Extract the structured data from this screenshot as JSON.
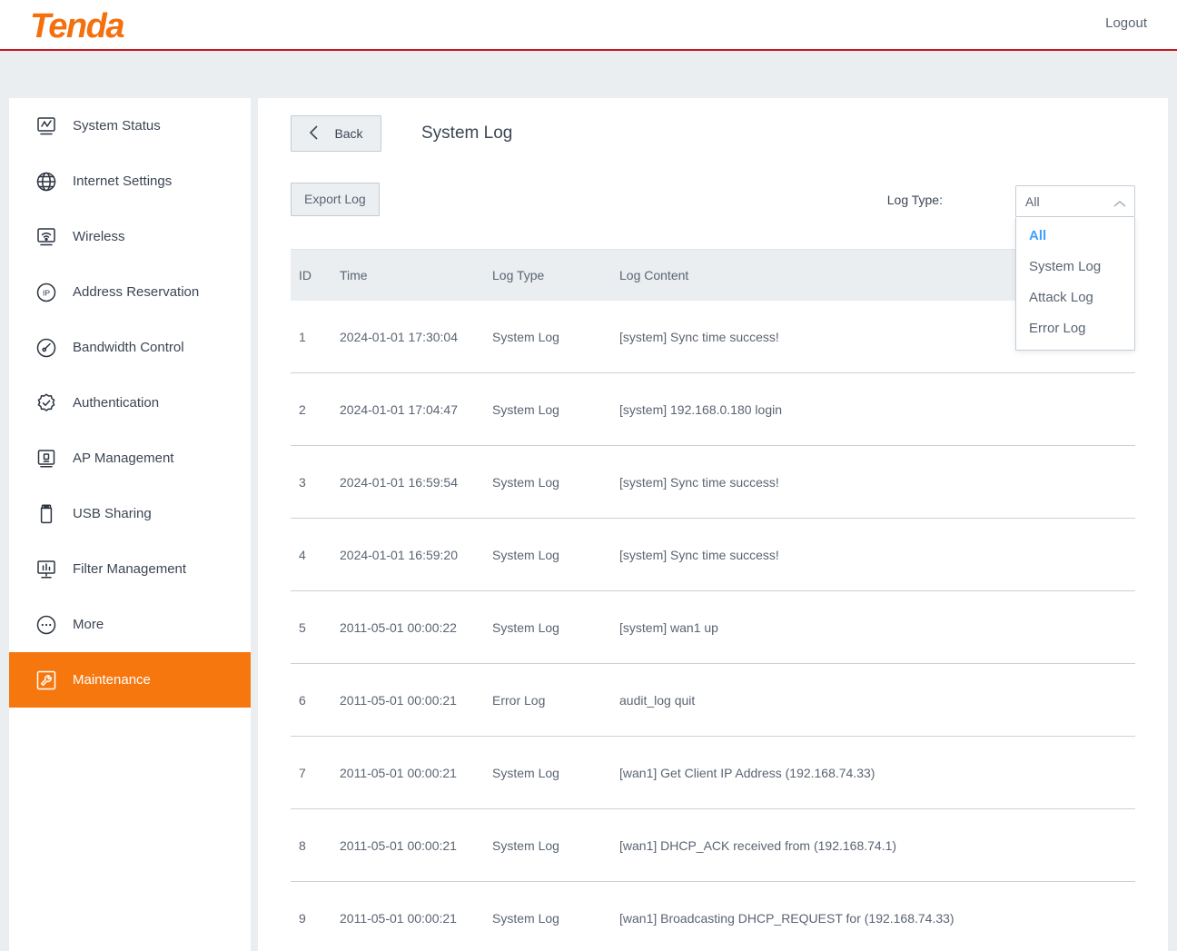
{
  "topbar": {
    "brand": "Tenda",
    "logout_label": "Logout"
  },
  "colors": {
    "brand_orange": "#f7770f",
    "accent_red": "#c8161e",
    "link_blue": "#409eff",
    "page_bg": "#eaeef0"
  },
  "sidebar": {
    "items": [
      {
        "label": "System Status",
        "icon": "monitor-chart-icon",
        "active": false
      },
      {
        "label": "Internet Settings",
        "icon": "globe-icon",
        "active": false
      },
      {
        "label": "Wireless",
        "icon": "wifi-monitor-icon",
        "active": false
      },
      {
        "label": "Address Reservation",
        "icon": "ip-circle-icon",
        "active": false
      },
      {
        "label": "Bandwidth Control",
        "icon": "gauge-icon",
        "active": false
      },
      {
        "label": "Authentication",
        "icon": "badge-check-icon",
        "active": false
      },
      {
        "label": "AP Management",
        "icon": "access-point-icon",
        "active": false
      },
      {
        "label": "USB Sharing",
        "icon": "usb-drive-icon",
        "active": false
      },
      {
        "label": "Filter Management",
        "icon": "filter-chart-icon",
        "active": false
      },
      {
        "label": "More",
        "icon": "ellipsis-circle-icon",
        "active": false
      },
      {
        "label": "Maintenance",
        "icon": "wrench-icon",
        "active": true
      }
    ]
  },
  "main": {
    "back_label": "Back",
    "back_icon": "chevron-left-icon",
    "page_title": "System Log",
    "export_label": "Export Log",
    "log_type_label": "Log Type:",
    "select": {
      "value": "All",
      "caret_icon": "chevron-up-icon",
      "expanded": true,
      "options": [
        "All",
        "System Log",
        "Attack Log",
        "Error Log"
      ],
      "selected_index": 0
    },
    "table": {
      "columns": [
        "ID",
        "Time",
        "Log Type",
        "Log Content"
      ],
      "rows": [
        {
          "id": "1",
          "time": "2024-01-01 17:30:04",
          "type": "System Log",
          "content": "[system] Sync time success!"
        },
        {
          "id": "2",
          "time": "2024-01-01 17:04:47",
          "type": "System Log",
          "content": "[system] 192.168.0.180 login"
        },
        {
          "id": "3",
          "time": "2024-01-01 16:59:54",
          "type": "System Log",
          "content": "[system] Sync time success!"
        },
        {
          "id": "4",
          "time": "2024-01-01 16:59:20",
          "type": "System Log",
          "content": "[system] Sync time success!"
        },
        {
          "id": "5",
          "time": "2011-05-01 00:00:22",
          "type": "System Log",
          "content": "[system] wan1 up"
        },
        {
          "id": "6",
          "time": "2011-05-01 00:00:21",
          "type": "Error Log",
          "content": "audit_log quit"
        },
        {
          "id": "7",
          "time": "2011-05-01 00:00:21",
          "type": "System Log",
          "content": "[wan1] Get Client IP Address (192.168.74.33)"
        },
        {
          "id": "8",
          "time": "2011-05-01 00:00:21",
          "type": "System Log",
          "content": "[wan1] DHCP_ACK received from (192.168.74.1)"
        },
        {
          "id": "9",
          "time": "2011-05-01 00:00:21",
          "type": "System Log",
          "content": "[wan1] Broadcasting DHCP_REQUEST for (192.168.74.33)"
        }
      ]
    }
  }
}
